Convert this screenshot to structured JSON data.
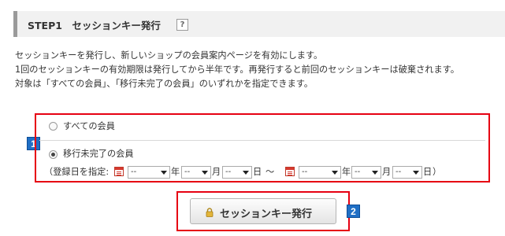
{
  "header": {
    "title": "STEP1　セッションキー発行",
    "help_icon": "?"
  },
  "description": {
    "lines": [
      "セッションキーを発行し、新しいショップの会員案内ページを有効にします。",
      "1回のセッションキーの有効期限は発行してから半年です。再発行すると前回のセッションキーは破棄されます。",
      "対象は「すべての会員」、「移行未完了の会員」のいずれかを指定できます。"
    ]
  },
  "options": {
    "all_members": {
      "label": "すべての会員",
      "checked": false
    },
    "incomplete_members": {
      "label": "移行未完了の会員",
      "checked": true
    }
  },
  "date_filter": {
    "prefix": "（登録日を指定:",
    "from": {
      "year": "--",
      "month": "--",
      "day": "--"
    },
    "to": {
      "year": "--",
      "month": "--",
      "day": "--"
    },
    "unit_year": "年",
    "unit_month": "月",
    "unit_day": "日",
    "separator": "～",
    "suffix": "）"
  },
  "annotations": {
    "badge1": "1",
    "badge2": "2"
  },
  "issue_button": {
    "label": "セッションキー発行"
  },
  "colors": {
    "highlight_border": "#e60012",
    "badge": "#1f6fc5",
    "header_bg": "#f1f1f1"
  },
  "icons": {
    "help": "question-icon",
    "calendar": "calendar-icon",
    "lock": "lock-icon"
  }
}
